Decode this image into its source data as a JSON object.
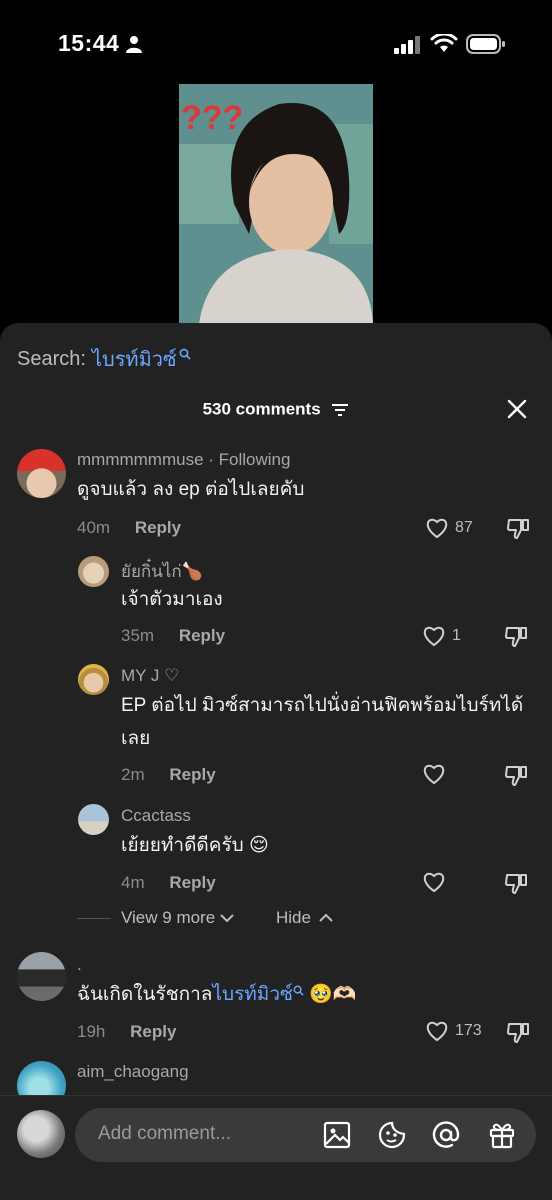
{
  "status_bar": {
    "time": "15:44"
  },
  "search": {
    "label": "Search:",
    "term": "ไบรท์มิวซ์"
  },
  "comments_header": {
    "count_label": "530 comments"
  },
  "comments": [
    {
      "username": "mmmmmmmuse · Following",
      "text": "ดูจบแล้ว ลง ep ต่อไปเลยคับ",
      "time": "40m",
      "reply": "Reply",
      "likes": "87"
    },
    {
      "username": "ยัยกิ๋นไก่🍗",
      "text": "เจ้าตัวมาเอง",
      "time": "35m",
      "reply": "Reply",
      "likes": "1"
    },
    {
      "username": "MY J ♡",
      "text": "EP ต่อไป มิวซ์สามารถไปนั่งอ่านฟิคพร้อมไบร์ทได้",
      "text2": "เลย",
      "time": "2m",
      "reply": "Reply",
      "likes": ""
    },
    {
      "username": "Ccactass",
      "text": "เย้ยยทำดีดีครับ 😌",
      "time": "4m",
      "reply": "Reply",
      "likes": ""
    },
    {
      "username": ".",
      "text_prefix": "ฉันเกิดในรัชกาล",
      "text_link": "ไบรท์มิวซ์",
      "text_suffix": " 🥹🫶🏻",
      "time": "19h",
      "reply": "Reply",
      "likes": "173"
    },
    {
      "username": "aim_chaogang",
      "text": ""
    }
  ],
  "thread": {
    "view_more": "View 9 more",
    "hide": "Hide"
  },
  "composer": {
    "placeholder": "Add comment..."
  },
  "colors": {
    "sheet": "#222222",
    "link": "#6aa8ff",
    "muted": "#8b8b8b"
  }
}
